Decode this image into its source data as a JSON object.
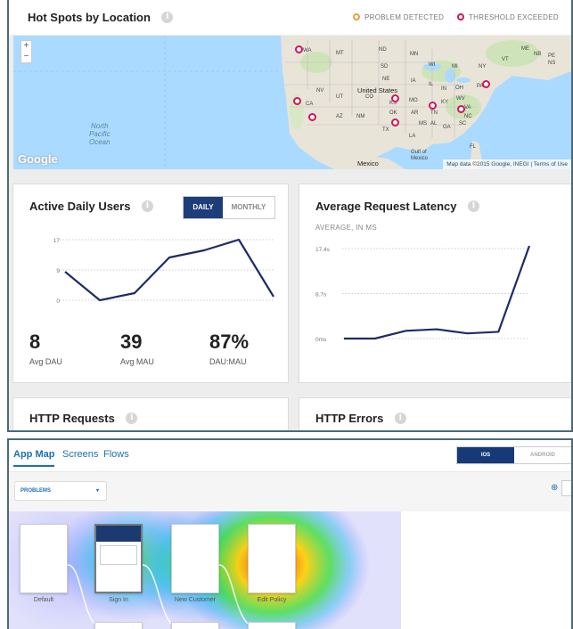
{
  "hotspots": {
    "title": "Hot Spots by Location",
    "legend_problem": "PROBLEM DETECTED",
    "legend_threshold": "THRESHOLD EXCEEDED",
    "colors": {
      "problem": "#e8a33d",
      "threshold": "#d4145a"
    },
    "map": {
      "zoom_in": "+",
      "zoom_out": "−",
      "ocean_label": "North\nPacific\nOcean",
      "google_logo": "Google",
      "attribution": "Map data ©2015 Google, INEGI | Terms of Use",
      "labels": [
        "WA",
        "MT",
        "ND",
        "MN",
        "WI",
        "MI",
        "NY",
        "ME",
        "VT",
        "NB",
        "NS",
        "PE",
        "SD",
        "NE",
        "IA",
        "IL",
        "IN",
        "OH",
        "PA",
        "NV",
        "UT",
        "CO",
        "United States",
        "KS",
        "MO",
        "KY",
        "WV",
        "VA",
        "CA",
        "AZ",
        "NM",
        "OK",
        "AR",
        "TN",
        "NC",
        "SC",
        "MS",
        "AL",
        "GA",
        "TX",
        "LA",
        "Mexico",
        "Gulf of Mexico",
        "FL"
      ]
    }
  },
  "active_users": {
    "title": "Active Daily Users",
    "toggle_daily": "DAILY",
    "toggle_monthly": "MONTHLY",
    "y_ticks": [
      "17",
      "9",
      "0"
    ],
    "stats": [
      {
        "value": "8",
        "label": "Avg DAU"
      },
      {
        "value": "39",
        "label": "Avg MAU"
      },
      {
        "value": "87%",
        "label": "DAU:MAU"
      }
    ]
  },
  "latency": {
    "title": "Average Request Latency",
    "subtitle": "AVERAGE, IN MS",
    "y_ticks": [
      "17.4s",
      "8.7s",
      "0ms"
    ]
  },
  "http_requests": {
    "title": "HTTP Requests"
  },
  "http_errors": {
    "title": "HTTP Errors"
  },
  "appmap": {
    "tabs": [
      "App Map",
      "Screens",
      "Flows"
    ],
    "os_ios": "IOS",
    "os_android": "ANDROID",
    "filter": "PROBLEMS",
    "screens": [
      "Default",
      "Sign In",
      "New Customer",
      "Edit Policy"
    ]
  },
  "chart_data": [
    {
      "type": "line",
      "title": "Active Daily Users",
      "x": [
        1,
        2,
        3,
        4,
        5,
        6,
        7
      ],
      "series": [
        {
          "values": [
            8,
            0,
            2,
            12,
            14,
            17,
            1
          ]
        }
      ],
      "ylim": [
        0,
        17
      ]
    },
    {
      "type": "line",
      "title": "Average Request Latency",
      "subtitle": "AVERAGE, IN MS",
      "x": [
        1,
        2,
        3,
        4,
        5,
        6,
        7
      ],
      "series": [
        {
          "values": [
            0,
            0,
            1.5,
            1.8,
            1.0,
            1.3,
            19.5
          ]
        }
      ],
      "ylim": [
        0,
        17.4
      ]
    }
  ]
}
